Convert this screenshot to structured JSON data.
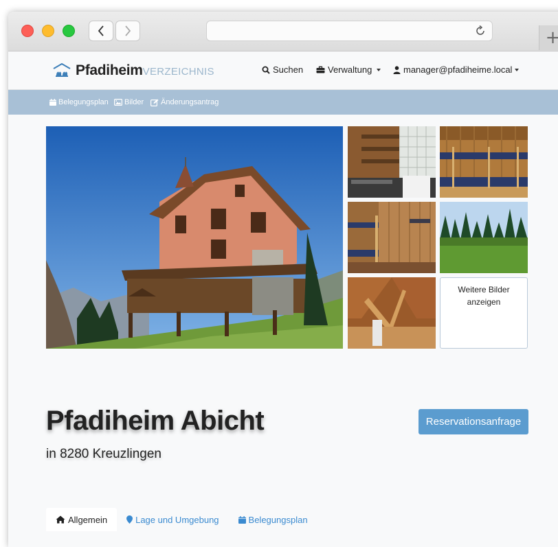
{
  "brand": {
    "strong": "Pfadiheim",
    "light": "VERZEICHNIS"
  },
  "nav": {
    "search": "Suchen",
    "admin": "Verwaltung",
    "user": "manager@pfadiheime.local"
  },
  "subnav": {
    "calendar": "Belegungsplan",
    "images": "Bilder",
    "change": "Änderungsantrag"
  },
  "gallery": {
    "more_line1": "Weitere Bilder",
    "more_line2": "anzeigen"
  },
  "hero": {
    "title": "Pfadiheim Abicht",
    "subtitle": "in 8280 Kreuzlingen"
  },
  "actions": {
    "reservation": "Reservationsanfrage"
  },
  "tabs": [
    {
      "label": "Allgemein",
      "active": true
    },
    {
      "label": "Lage und Umgebung",
      "active": false
    },
    {
      "label": "Belegungsplan",
      "active": false
    }
  ],
  "colors": {
    "accent": "#5b9ccf",
    "subnav": "#a8c0d6",
    "link": "#3a8ad0"
  }
}
